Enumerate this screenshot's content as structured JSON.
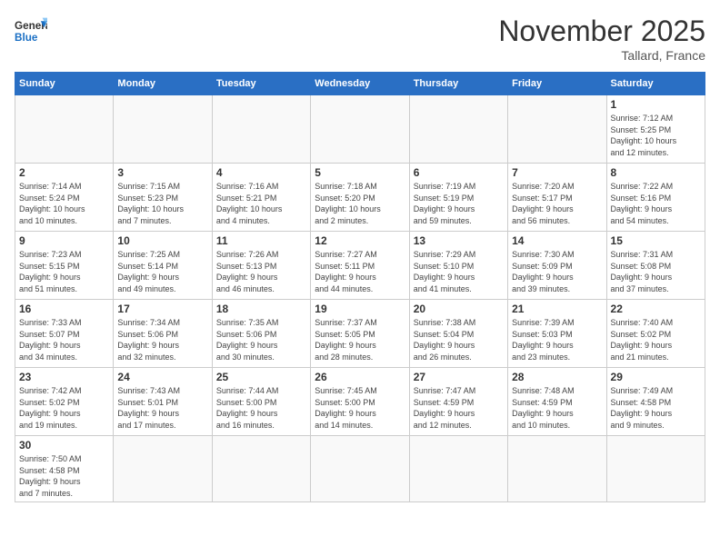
{
  "header": {
    "logo_general": "General",
    "logo_blue": "Blue",
    "month_title": "November 2025",
    "location": "Tallard, France"
  },
  "days_of_week": [
    "Sunday",
    "Monday",
    "Tuesday",
    "Wednesday",
    "Thursday",
    "Friday",
    "Saturday"
  ],
  "weeks": [
    [
      {
        "day": "",
        "info": ""
      },
      {
        "day": "",
        "info": ""
      },
      {
        "day": "",
        "info": ""
      },
      {
        "day": "",
        "info": ""
      },
      {
        "day": "",
        "info": ""
      },
      {
        "day": "",
        "info": ""
      },
      {
        "day": "1",
        "info": "Sunrise: 7:12 AM\nSunset: 5:25 PM\nDaylight: 10 hours\nand 12 minutes."
      }
    ],
    [
      {
        "day": "2",
        "info": "Sunrise: 7:14 AM\nSunset: 5:24 PM\nDaylight: 10 hours\nand 10 minutes."
      },
      {
        "day": "3",
        "info": "Sunrise: 7:15 AM\nSunset: 5:23 PM\nDaylight: 10 hours\nand 7 minutes."
      },
      {
        "day": "4",
        "info": "Sunrise: 7:16 AM\nSunset: 5:21 PM\nDaylight: 10 hours\nand 4 minutes."
      },
      {
        "day": "5",
        "info": "Sunrise: 7:18 AM\nSunset: 5:20 PM\nDaylight: 10 hours\nand 2 minutes."
      },
      {
        "day": "6",
        "info": "Sunrise: 7:19 AM\nSunset: 5:19 PM\nDaylight: 9 hours\nand 59 minutes."
      },
      {
        "day": "7",
        "info": "Sunrise: 7:20 AM\nSunset: 5:17 PM\nDaylight: 9 hours\nand 56 minutes."
      },
      {
        "day": "8",
        "info": "Sunrise: 7:22 AM\nSunset: 5:16 PM\nDaylight: 9 hours\nand 54 minutes."
      }
    ],
    [
      {
        "day": "9",
        "info": "Sunrise: 7:23 AM\nSunset: 5:15 PM\nDaylight: 9 hours\nand 51 minutes."
      },
      {
        "day": "10",
        "info": "Sunrise: 7:25 AM\nSunset: 5:14 PM\nDaylight: 9 hours\nand 49 minutes."
      },
      {
        "day": "11",
        "info": "Sunrise: 7:26 AM\nSunset: 5:13 PM\nDaylight: 9 hours\nand 46 minutes."
      },
      {
        "day": "12",
        "info": "Sunrise: 7:27 AM\nSunset: 5:11 PM\nDaylight: 9 hours\nand 44 minutes."
      },
      {
        "day": "13",
        "info": "Sunrise: 7:29 AM\nSunset: 5:10 PM\nDaylight: 9 hours\nand 41 minutes."
      },
      {
        "day": "14",
        "info": "Sunrise: 7:30 AM\nSunset: 5:09 PM\nDaylight: 9 hours\nand 39 minutes."
      },
      {
        "day": "15",
        "info": "Sunrise: 7:31 AM\nSunset: 5:08 PM\nDaylight: 9 hours\nand 37 minutes."
      }
    ],
    [
      {
        "day": "16",
        "info": "Sunrise: 7:33 AM\nSunset: 5:07 PM\nDaylight: 9 hours\nand 34 minutes."
      },
      {
        "day": "17",
        "info": "Sunrise: 7:34 AM\nSunset: 5:06 PM\nDaylight: 9 hours\nand 32 minutes."
      },
      {
        "day": "18",
        "info": "Sunrise: 7:35 AM\nSunset: 5:06 PM\nDaylight: 9 hours\nand 30 minutes."
      },
      {
        "day": "19",
        "info": "Sunrise: 7:37 AM\nSunset: 5:05 PM\nDaylight: 9 hours\nand 28 minutes."
      },
      {
        "day": "20",
        "info": "Sunrise: 7:38 AM\nSunset: 5:04 PM\nDaylight: 9 hours\nand 26 minutes."
      },
      {
        "day": "21",
        "info": "Sunrise: 7:39 AM\nSunset: 5:03 PM\nDaylight: 9 hours\nand 23 minutes."
      },
      {
        "day": "22",
        "info": "Sunrise: 7:40 AM\nSunset: 5:02 PM\nDaylight: 9 hours\nand 21 minutes."
      }
    ],
    [
      {
        "day": "23",
        "info": "Sunrise: 7:42 AM\nSunset: 5:02 PM\nDaylight: 9 hours\nand 19 minutes."
      },
      {
        "day": "24",
        "info": "Sunrise: 7:43 AM\nSunset: 5:01 PM\nDaylight: 9 hours\nand 17 minutes."
      },
      {
        "day": "25",
        "info": "Sunrise: 7:44 AM\nSunset: 5:00 PM\nDaylight: 9 hours\nand 16 minutes."
      },
      {
        "day": "26",
        "info": "Sunrise: 7:45 AM\nSunset: 5:00 PM\nDaylight: 9 hours\nand 14 minutes."
      },
      {
        "day": "27",
        "info": "Sunrise: 7:47 AM\nSunset: 4:59 PM\nDaylight: 9 hours\nand 12 minutes."
      },
      {
        "day": "28",
        "info": "Sunrise: 7:48 AM\nSunset: 4:59 PM\nDaylight: 9 hours\nand 10 minutes."
      },
      {
        "day": "29",
        "info": "Sunrise: 7:49 AM\nSunset: 4:58 PM\nDaylight: 9 hours\nand 9 minutes."
      }
    ],
    [
      {
        "day": "30",
        "info": "Sunrise: 7:50 AM\nSunset: 4:58 PM\nDaylight: 9 hours\nand 7 minutes."
      },
      {
        "day": "",
        "info": ""
      },
      {
        "day": "",
        "info": ""
      },
      {
        "day": "",
        "info": ""
      },
      {
        "day": "",
        "info": ""
      },
      {
        "day": "",
        "info": ""
      },
      {
        "day": "",
        "info": ""
      }
    ]
  ]
}
